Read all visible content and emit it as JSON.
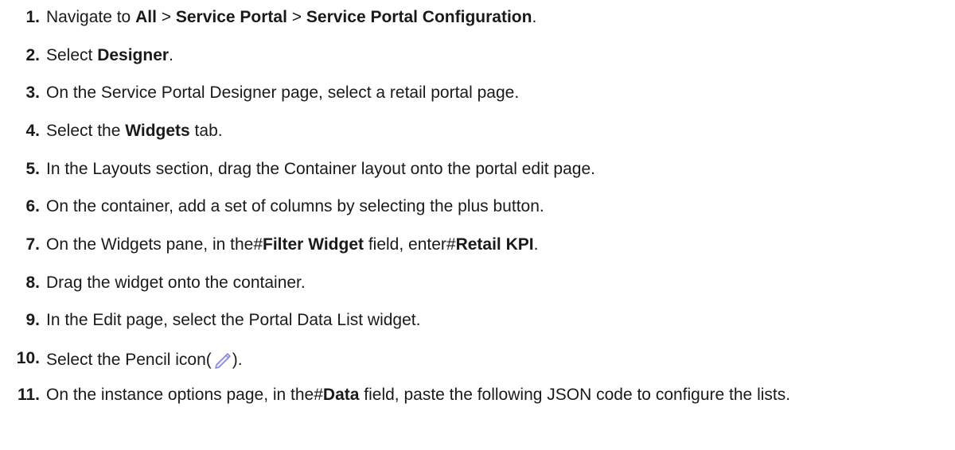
{
  "steps": [
    {
      "num": "1.",
      "parts": [
        {
          "t": "Navigate to "
        },
        {
          "t": "All",
          "b": true
        },
        {
          "t": " > "
        },
        {
          "t": "Service Portal",
          "b": true
        },
        {
          "t": " > "
        },
        {
          "t": "Service Portal Configuration",
          "b": true
        },
        {
          "t": "."
        }
      ]
    },
    {
      "num": "2.",
      "parts": [
        {
          "t": "Select "
        },
        {
          "t": "Designer",
          "b": true
        },
        {
          "t": "."
        }
      ]
    },
    {
      "num": "3.",
      "parts": [
        {
          "t": "On the Service Portal Designer page, select a retail portal page."
        }
      ]
    },
    {
      "num": "4.",
      "parts": [
        {
          "t": "Select the "
        },
        {
          "t": "Widgets",
          "b": true
        },
        {
          "t": " tab."
        }
      ]
    },
    {
      "num": "5.",
      "parts": [
        {
          "t": "In the Layouts section, drag the Container layout onto the portal edit page."
        }
      ]
    },
    {
      "num": "6.",
      "parts": [
        {
          "t": "On the container, add a set of columns by selecting the plus button."
        }
      ]
    },
    {
      "num": "7.",
      "parts": [
        {
          "t": "On the Widgets pane, in the#"
        },
        {
          "t": "Filter Widget",
          "b": true
        },
        {
          "t": " field, enter#"
        },
        {
          "t": "Retail KPI",
          "b": true
        },
        {
          "t": "."
        }
      ]
    },
    {
      "num": "8.",
      "parts": [
        {
          "t": "Drag the widget onto the container."
        }
      ]
    },
    {
      "num": "9.",
      "parts": [
        {
          "t": "In the Edit page, select the Portal Data List widget."
        }
      ]
    },
    {
      "num": "10.",
      "parts": [
        {
          "t": "Select the Pencil icon("
        },
        {
          "icon": "pencil-icon"
        },
        {
          "t": ")."
        }
      ]
    },
    {
      "num": "11.",
      "parts": [
        {
          "t": "On the instance options page, in the#"
        },
        {
          "t": "Data",
          "b": true
        },
        {
          "t": " field, paste the following JSON code to configure the lists."
        }
      ]
    }
  ],
  "colors": {
    "text": "#1a1a1a",
    "icon_stroke": "#8a86d8",
    "icon_fill": "#eeeeff"
  }
}
